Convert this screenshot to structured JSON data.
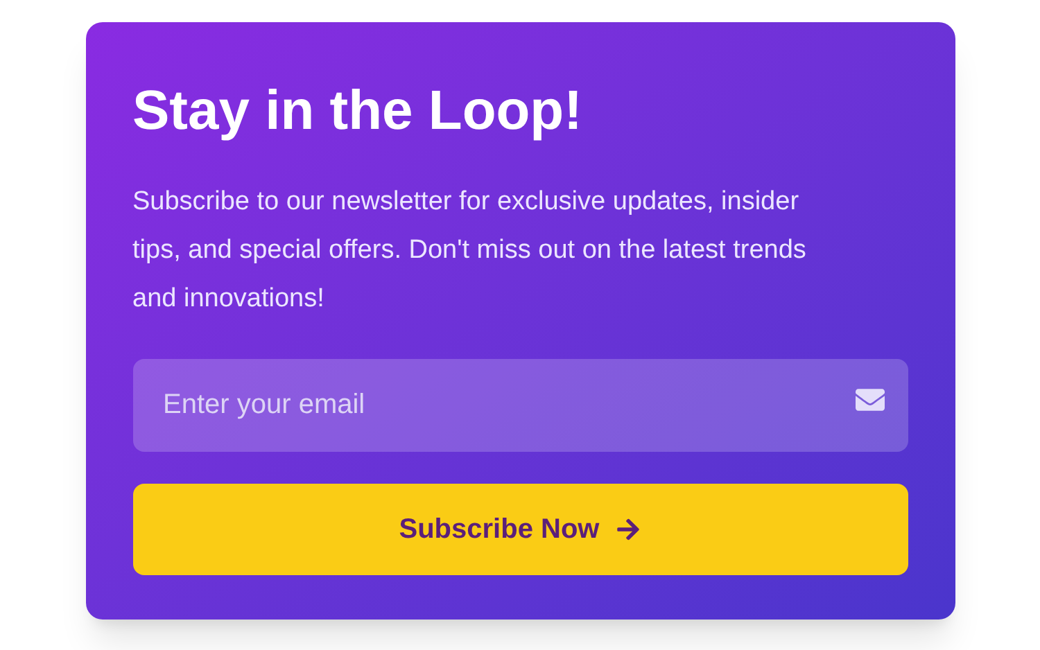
{
  "card": {
    "title": "Stay in the Loop!",
    "description": "Subscribe to our newsletter for exclusive updates, insider tips, and special offers. Don't miss out on the latest trends and innovations!",
    "email_field": {
      "placeholder": "Enter your email"
    },
    "subscribe_button": {
      "label": "Subscribe Now"
    }
  }
}
